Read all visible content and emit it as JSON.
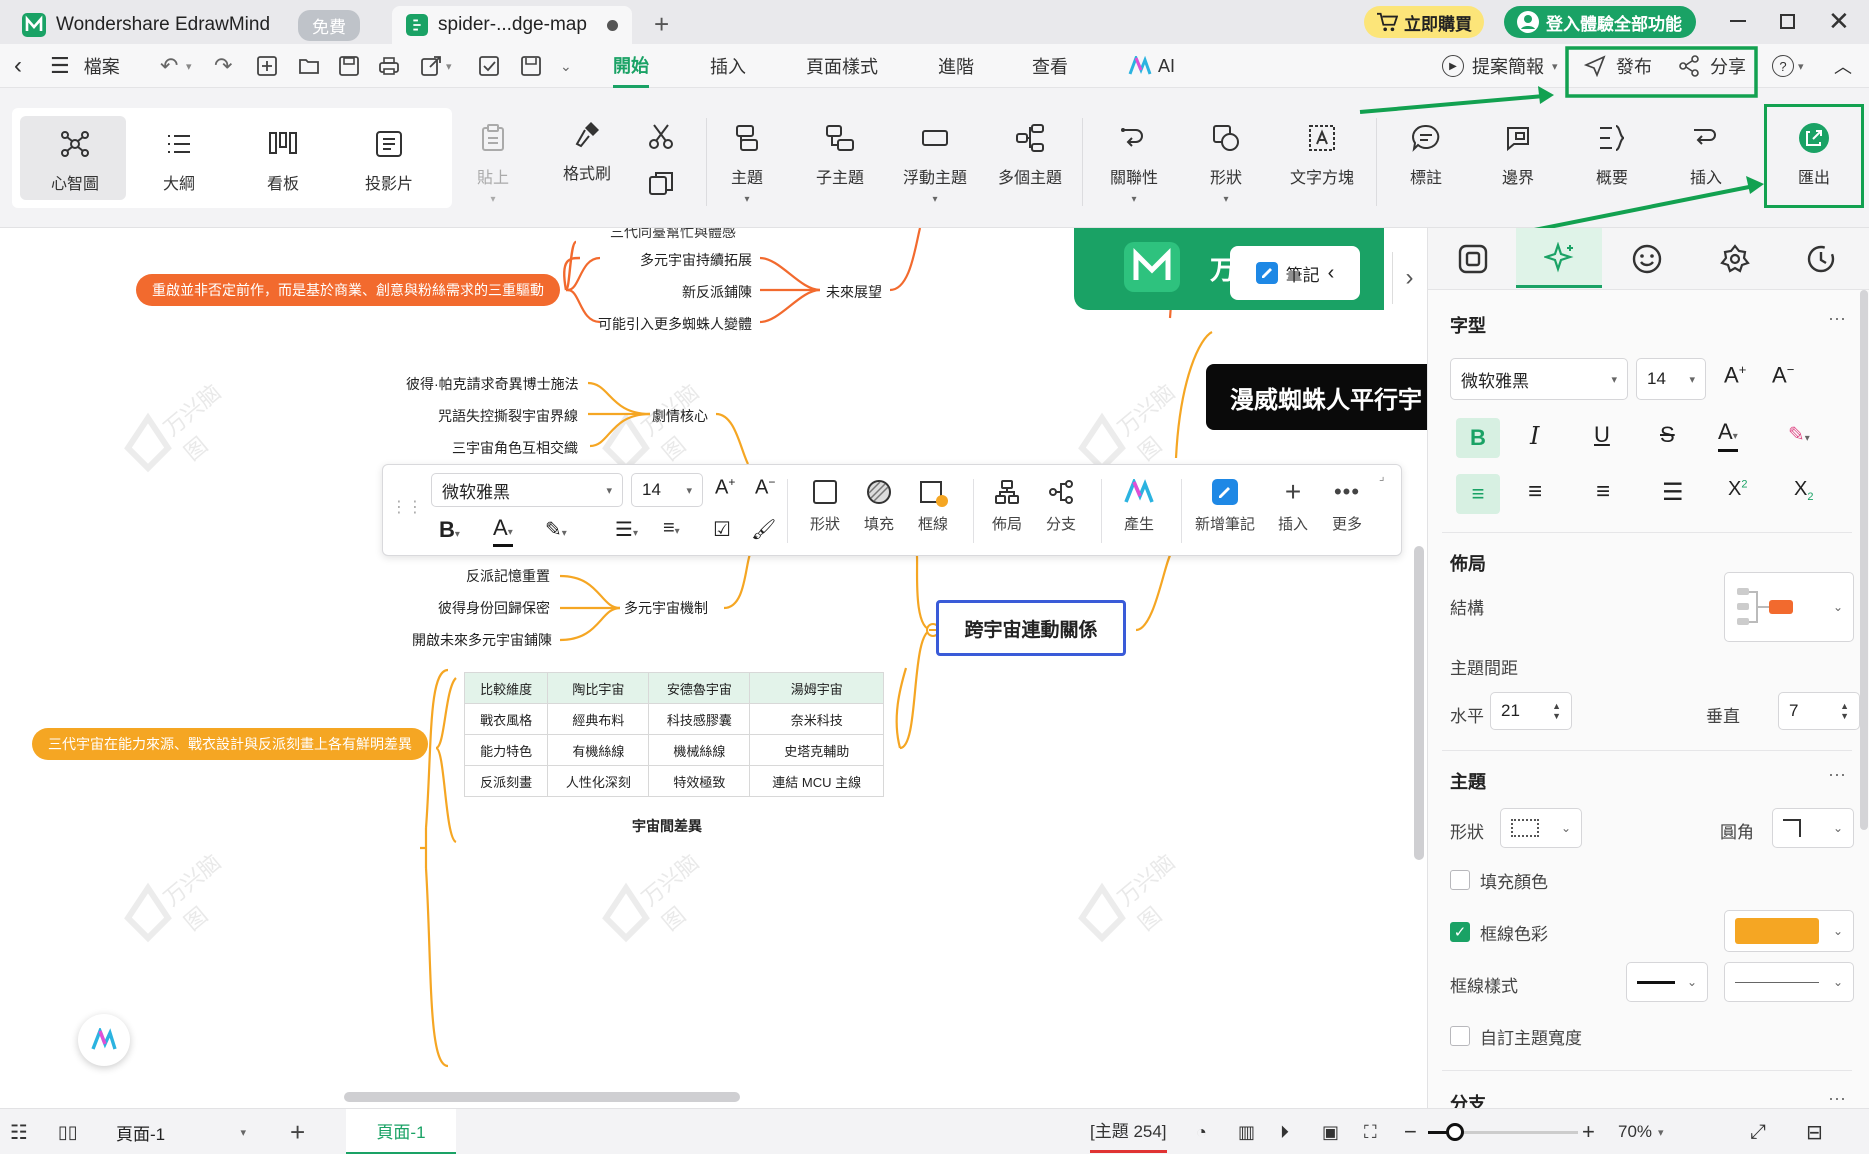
{
  "titlebar": {
    "app_name": "Wondershare EdrawMind",
    "free_badge": "免費",
    "doc_tab": "spider-...dge-map",
    "buy_label": "立即購買",
    "login_label": "登入體驗全部功能"
  },
  "menubar": {
    "file": "檔案",
    "tabs": [
      "開始",
      "插入",
      "頁面樣式",
      "進階",
      "查看",
      "AI"
    ],
    "active_tab": "開始",
    "present": "提案簡報",
    "publish": "發布",
    "share": "分享"
  },
  "ribbon": {
    "views": [
      "心智圖",
      "大綱",
      "看板",
      "投影片"
    ],
    "paste": "貼上",
    "format_painter": "格式刷",
    "tools": [
      "主題",
      "子主題",
      "浮動主題",
      "多個主題",
      "關聯性",
      "形狀",
      "文字方塊",
      "標註",
      "邊界",
      "概要",
      "插入"
    ],
    "export": "匯出"
  },
  "canvas": {
    "center_topic": "跨宇宙連動關係",
    "main_title": "漫威蜘蛛人平行宇",
    "logo_text": "万",
    "notes_label": "筆記",
    "watermark": "万兴脑图",
    "cut_top": "三代同臺幫忙與體感",
    "future_branch": "未來展望",
    "future_items": [
      "多元宇宙持續拓展",
      "新反派鋪陳",
      "可能引入更多蜘蛛人變體"
    ],
    "future_callout": "重啟並非否定前作，而是基於商業、創意與粉絲需求的三重驅動",
    "plot_branch": "劇情核心",
    "plot_items": [
      "彼得·帕克請求奇異博士施法",
      "咒語失控撕裂宇宙界線",
      "三宇宙角色互相交織"
    ],
    "mech_branch": "多元宇宙機制",
    "mech_items": [
      "反派記憶重置",
      "彼得身份回歸保密",
      "開啟未來多元宇宙鋪陳"
    ],
    "table_caption": "宇宙間差異",
    "table_callout": "三代宇宙在能力來源、戰衣設計與反派刻畫上各有鮮明差異",
    "table": [
      [
        "比較維度",
        "陶比宇宙",
        "安德魯宇宙",
        "湯姆宇宙"
      ],
      [
        "戰衣風格",
        "經典布料",
        "科技感膠囊",
        "奈米科技"
      ],
      [
        "能力特色",
        "有機絲線",
        "機械絲線",
        "史塔克輔助"
      ],
      [
        "反派刻畫",
        "人性化深刻",
        "特效極致",
        "連結 MCU 主線"
      ]
    ]
  },
  "floating_toolbar": {
    "font": "微软雅黑",
    "size": "14",
    "buttons": [
      "形狀",
      "填充",
      "框線",
      "佈局",
      "分支",
      "產生",
      "新增筆記",
      "插入",
      "更多"
    ]
  },
  "panel": {
    "font_section": "字型",
    "font_family": "微软雅黑",
    "font_size": "14",
    "layout_section": "佈局",
    "structure_label": "結構",
    "spacing_label": "主題間距",
    "horizontal_label": "水平",
    "horizontal_value": "21",
    "vertical_label": "垂直",
    "vertical_value": "7",
    "topic_section": "主題",
    "shape_label": "形狀",
    "corner_label": "圓角",
    "fill_label": "填充顏色",
    "border_color_label": "框線色彩",
    "border_style_label": "框線樣式",
    "custom_width_label": "自訂主題寬度",
    "branch_section": "分支"
  },
  "statusbar": {
    "page_select": "頁面-1",
    "page_tab": "頁面-1",
    "topic_count": "[主題 254]",
    "zoom": "70%"
  },
  "colors": {
    "accent_green": "#1aa265",
    "annotation_green": "#12a150",
    "orange": "#f5a623",
    "red_orange": "#f26a2e",
    "center_border": "#3a5bd8"
  }
}
